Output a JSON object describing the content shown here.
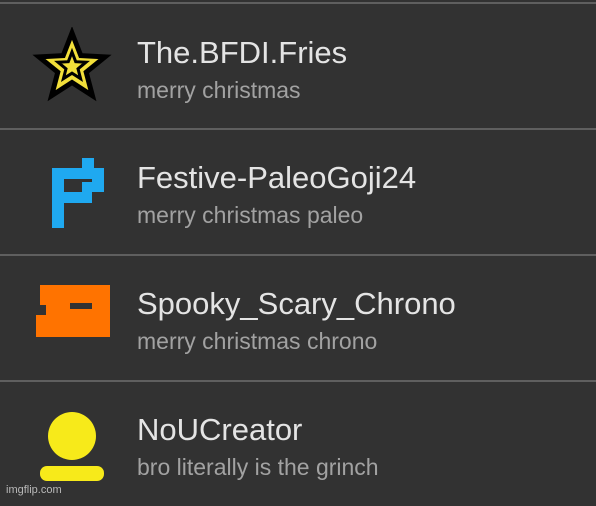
{
  "comments": [
    {
      "username": "The.BFDI.Fries",
      "message": "merry christmas",
      "avatar_icon": "star-icon",
      "avatar_color": "#f2df3a"
    },
    {
      "username": "Festive-PaleoGoji24",
      "message": "merry christmas paleo",
      "avatar_icon": "pixel-p-icon",
      "avatar_color": "#1fa9f0"
    },
    {
      "username": "Spooky_Scary_Chrono",
      "message": "merry christmas chrono",
      "avatar_icon": "pixel-block-icon",
      "avatar_color": "#ff7300"
    },
    {
      "username": "NoUCreator",
      "message": "bro literally is the grinch",
      "avatar_icon": "person-silhouette-icon",
      "avatar_color": "#f7ea1a"
    }
  ],
  "watermark": "imgflip.com"
}
